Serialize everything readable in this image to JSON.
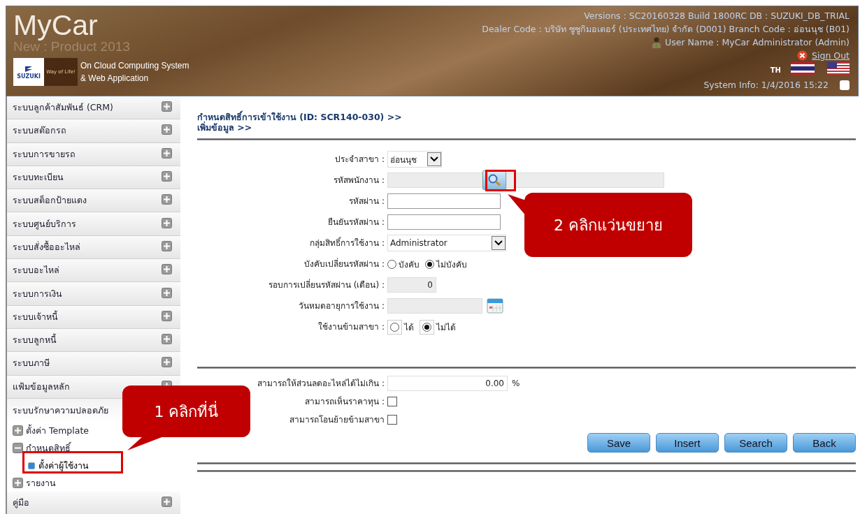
{
  "header": {
    "title": "MyCar",
    "subtitle": "New : Product 2013",
    "logo_brand": "SUZUKI",
    "logo_slogan": "Way of Life!",
    "tagline": [
      "On Cloud Computing System",
      "& Web Application"
    ],
    "info": [
      "Versions : SC20160328 Build 1800RC DB : SUZUKI_DB_TRIAL",
      "Dealer Code : บริษัท ซูซูกิมอเตอร์ (ประเทศไทย) จำกัด (D001)  Branch Code : อ่อนนุช (B01)"
    ],
    "user": "User Name : MyCar Administrator  (Admin)",
    "sign_out": "Sign Out",
    "language": "TH",
    "system_info": "System Info: 1/4/2016 15:22",
    "checkbox": {
      "checked": false
    }
  },
  "sidebar": {
    "items": [
      {
        "label": "ระบบลูกค้าสัมพันธ์ (CRM)",
        "expanded": false
      },
      {
        "label": "ระบบสต๊อกรถ",
        "expanded": false
      },
      {
        "label": "ระบบการขายรถ",
        "expanded": false
      },
      {
        "label": "ระบบทะเบียน",
        "expanded": false
      },
      {
        "label": "ระบบสต็อกป้ายแดง",
        "expanded": false
      },
      {
        "label": "ระบบศูนย์บริการ",
        "expanded": false
      },
      {
        "label": "ระบบสั่งซื้ออะไหล่",
        "expanded": false
      },
      {
        "label": "ระบบอะไหล่",
        "expanded": false
      },
      {
        "label": "ระบบการเงิน",
        "expanded": false
      },
      {
        "label": "ระบบเจ้าหนี้",
        "expanded": false
      },
      {
        "label": "ระบบลูกหนี้",
        "expanded": false
      },
      {
        "label": "ระบบภาษี",
        "expanded": false
      },
      {
        "label": "แฟ้มข้อมูลหลัก",
        "expanded": false
      },
      {
        "label": "ระบบรักษาความปลอดภัย",
        "expanded": true,
        "children": [
          {
            "label": "ตั้งค่า Template",
            "expanded": false
          },
          {
            "label": "กำหนดสิทธิ์",
            "expanded": true,
            "children": [
              {
                "label": "ตั้งค่าผู้ใช้งาน",
                "selected": true
              }
            ]
          },
          {
            "label": "รายงาน",
            "expanded": false
          }
        ]
      },
      {
        "label": "คู่มือ",
        "expanded": false
      }
    ]
  },
  "breadcrumb": [
    "กำหนดสิทธิ์การเข้าใช้งาน (ID: SCR140-030) >>",
    "เพิ่มข้อมูล >>"
  ],
  "form": {
    "fields": [
      {
        "kind": "select",
        "label": "ประจำสาขา :",
        "value": "อ่อนนุช"
      },
      {
        "kind": "lookup",
        "label": "รหัสพนักงาน :",
        "disabled": true
      },
      {
        "kind": "password",
        "label": "รหัสผ่าน :"
      },
      {
        "kind": "password",
        "label": "ยืนยันรหัสผ่าน :"
      },
      {
        "kind": "select",
        "label": "กลุ่มสิทธิ์การใช้งาน :",
        "value": "Administrator"
      },
      {
        "kind": "radio",
        "label": "บังคับเปลี่ยนรหัสผ่าน :",
        "options": [
          {
            "label": "บังคับ",
            "selected": false
          },
          {
            "label": "ไม่บังคับ",
            "selected": true
          }
        ]
      },
      {
        "kind": "number",
        "label": "รอบการเปลี่ยนรหัสผ่าน (เดือน) :",
        "value": "0",
        "disabled": true
      },
      {
        "kind": "date",
        "label": "วันหมดอายุการใช้งาน :",
        "disabled": true
      },
      {
        "kind": "radio_boxed",
        "label": "ใช้งานข้ามสาขา :",
        "options": [
          {
            "label": "ได้",
            "selected": false
          },
          {
            "label": "ไม่ได้",
            "selected": true
          }
        ]
      }
    ]
  },
  "permissions": {
    "fields": [
      {
        "kind": "number",
        "label": "สามารถให้ส่วนลดอะไหล่ได้ไม่เกิน :",
        "value": "0.00",
        "suffix": "%",
        "disabled": false
      },
      {
        "kind": "checkbox",
        "label": "สามารถเห็นราคาทุน :",
        "checked": false
      },
      {
        "kind": "checkbox",
        "label": "สามารถโอนย้ายข้ามสาขา",
        "checked": false
      }
    ]
  },
  "buttons": [
    "Save",
    "Insert",
    "Search",
    "Back"
  ],
  "callouts": [
    {
      "text": "2 คลิกแว่นขยาย"
    },
    {
      "text": "1 คลิกที่นี่"
    }
  ]
}
